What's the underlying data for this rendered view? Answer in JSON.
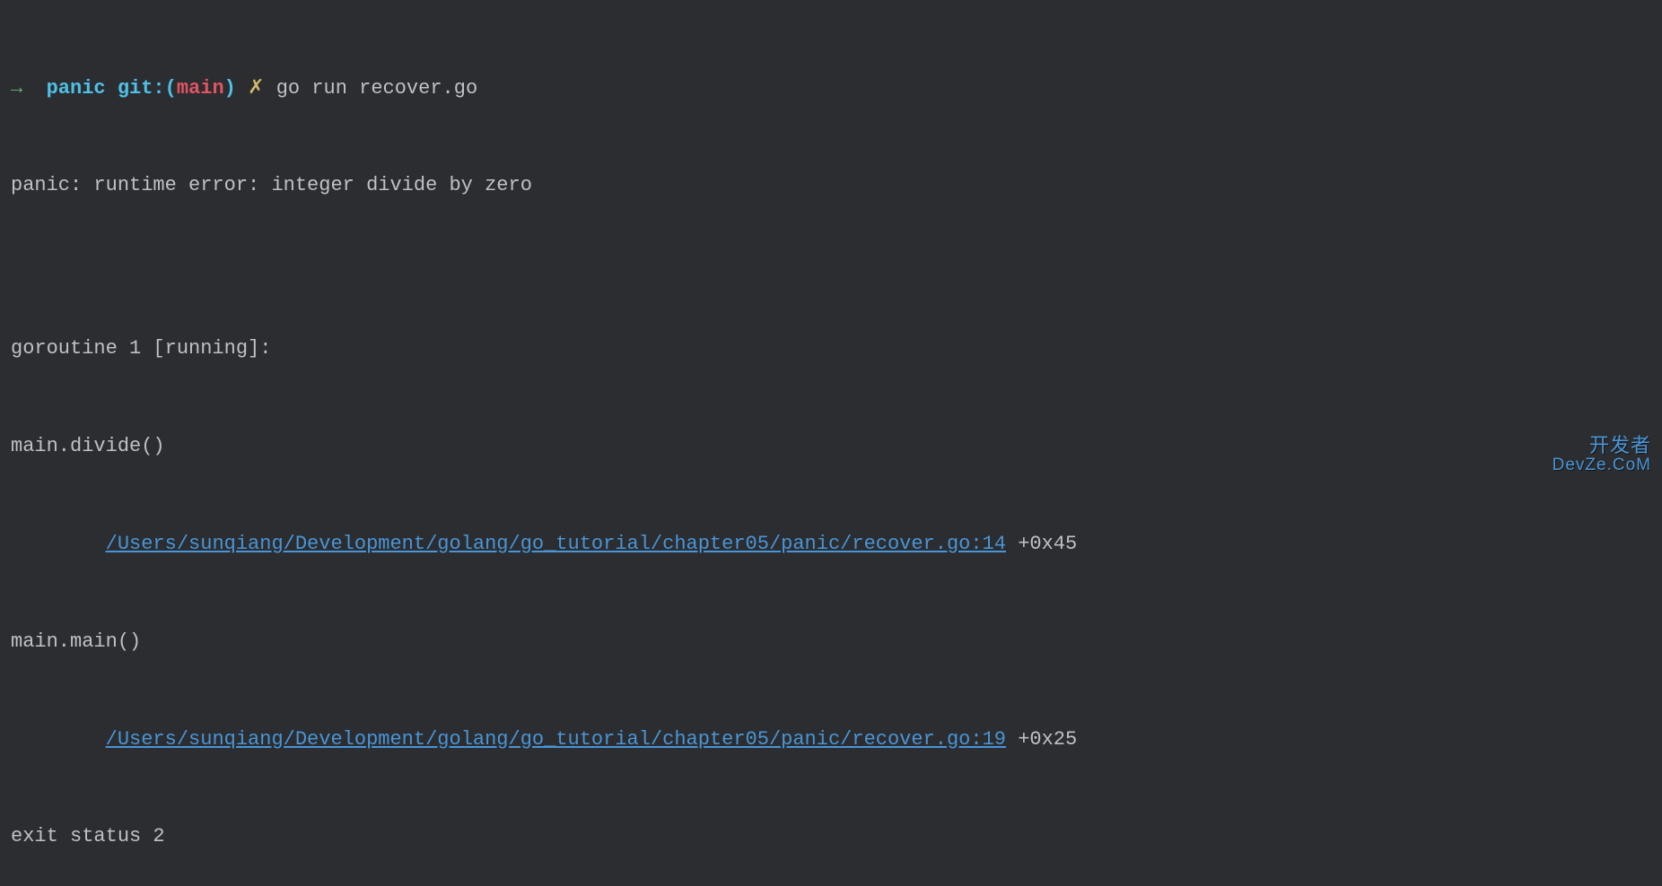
{
  "prompt": {
    "arrow": "→",
    "dir": "panic",
    "git_label": "git:",
    "git_open": "(",
    "git_branch": "main",
    "git_close": ")",
    "x": "✗",
    "command": "go run recover.go"
  },
  "output": {
    "panic_line": "panic: runtime error: integer divide by zero",
    "blank": "",
    "goroutine_line": "goroutine 1 [running]:",
    "frames": [
      {
        "func": "main.divide()",
        "indent": "        ",
        "path": "/Users/sunqiang/Development/golang/go_tutorial/chapter05/panic/recover.go:14",
        "offset": " +0x45"
      },
      {
        "func": "main.main()",
        "indent": "        ",
        "path": "/Users/sunqiang/Development/golang/go_tutorial/chapter05/panic/recover.go:19",
        "offset": " +0x25"
      }
    ],
    "exit_line": "exit status 2"
  },
  "watermark": {
    "top": "开发者",
    "bottom": "DevZe.CoM"
  }
}
